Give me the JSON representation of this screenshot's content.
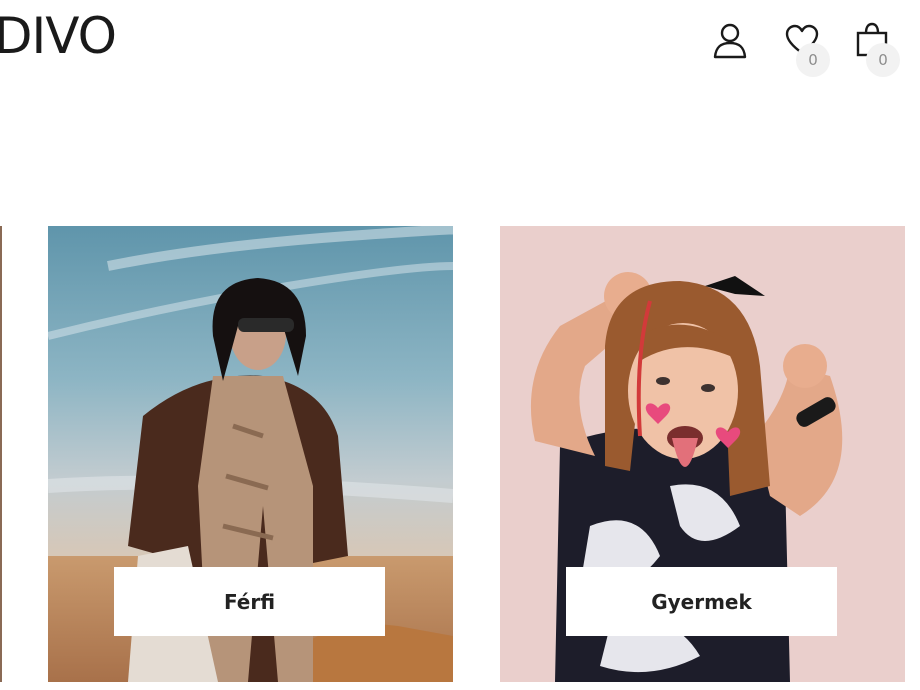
{
  "header": {
    "logo_text": "DIVO",
    "account_icon": "user-icon",
    "wishlist_icon": "heart-icon",
    "cart_icon": "shopping-bag-icon",
    "wishlist_count": "0",
    "cart_count": "0"
  },
  "categories": [
    {
      "label": "Férfi",
      "image": "man-in-desert-photo"
    },
    {
      "label": "Gyermek",
      "image": "child-on-pink-photo"
    }
  ]
}
